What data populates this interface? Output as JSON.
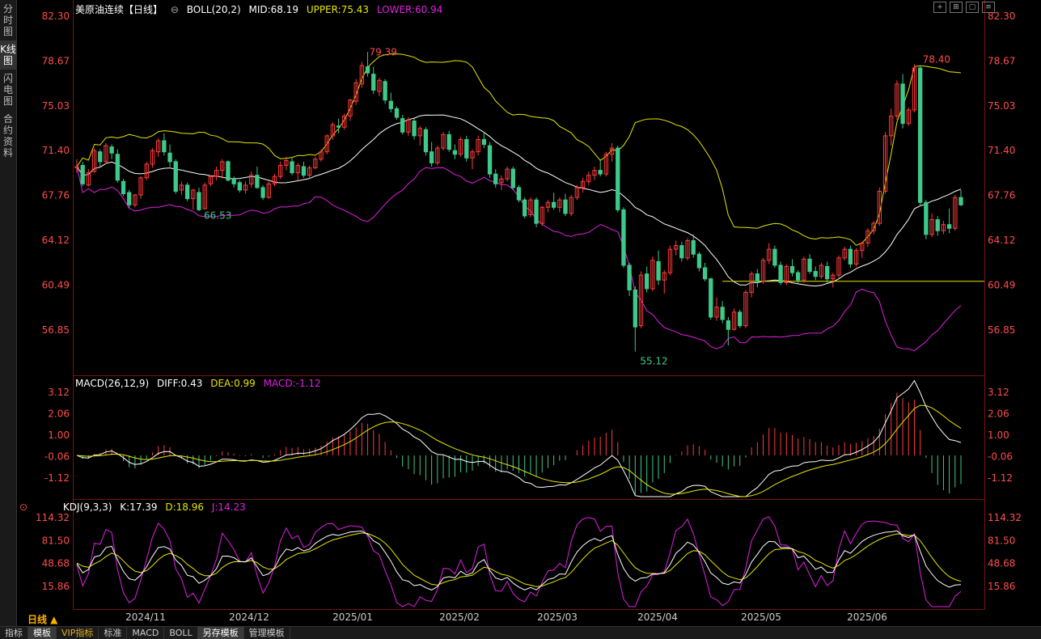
{
  "sidebar": {
    "tabs": [
      {
        "label": "分时图"
      },
      {
        "label": "K线图",
        "active": true
      },
      {
        "label": "闪电图"
      },
      {
        "label": "合约资料"
      }
    ]
  },
  "main": {
    "title": "美原油连续【日线】",
    "boll": "BOLL(20,2)",
    "mid": "MID:68.19",
    "upper": "UPPER:75.43",
    "lower": "LOWER:60.94",
    "y_ticks": [
      "82.30",
      "78.67",
      "75.03",
      "71.40",
      "67.76",
      "64.12",
      "60.49",
      "56.85"
    ],
    "annotations": {
      "high_left": "79.39",
      "high_right": "78.40",
      "low_mid": "55.12",
      "low_left": "66.53"
    },
    "colors": {
      "up": "#ff3b3b",
      "down": "#3ec98a",
      "mid": "#ffffff",
      "upper": "#e6e600",
      "lower": "#e020e0"
    }
  },
  "macd": {
    "title": "MACD(26,12,9)",
    "diff": "DIFF:0.43",
    "dea": "DEA:0.99",
    "macd": "MACD:-1.12",
    "y_ticks": [
      "3.12",
      "2.06",
      "1.00",
      "-0.06",
      "-1.12"
    ]
  },
  "kdj": {
    "title": "KDJ(9,3,3)",
    "k": "K:17.39",
    "d": "D:18.96",
    "j": "J:14.23",
    "y_ticks": [
      "114.32",
      "81.50",
      "48.68",
      "15.86"
    ]
  },
  "x_axis": {
    "period": "日线 ▲",
    "dates": [
      "2024/11",
      "2024/12",
      "2025/01",
      "2025/02",
      "2025/03",
      "2025/04",
      "2025/05",
      "2025/06"
    ]
  },
  "bottombar": {
    "tabs": [
      {
        "label": "指标"
      },
      {
        "label": "模板",
        "active": true
      },
      {
        "label": "VIP指标",
        "vip": true
      },
      {
        "label": "标准"
      },
      {
        "label": "MACD"
      },
      {
        "label": "BOLL"
      },
      {
        "label": "另存模板",
        "active": true
      },
      {
        "label": "管理模板"
      }
    ]
  },
  "chart_data": {
    "type": "candlestick",
    "yrange": [
      55.12,
      82.3
    ],
    "candles": [
      [
        70.0,
        70.7,
        69.6,
        70.1
      ],
      [
        70.2,
        70.5,
        68.5,
        68.7
      ],
      [
        68.6,
        69.9,
        68.5,
        69.6
      ],
      [
        69.7,
        71.6,
        69.6,
        71.4
      ],
      [
        71.3,
        71.5,
        70.0,
        70.5
      ],
      [
        70.5,
        72.0,
        70.3,
        71.8
      ],
      [
        71.7,
        71.9,
        70.7,
        71.2
      ],
      [
        71.1,
        71.5,
        68.8,
        69.0
      ],
      [
        68.9,
        69.1,
        67.7,
        67.9
      ],
      [
        68.0,
        68.2,
        66.7,
        67.0
      ],
      [
        67.0,
        67.9,
        66.8,
        67.8
      ],
      [
        67.8,
        69.3,
        67.5,
        69.2
      ],
      [
        69.2,
        70.5,
        69.0,
        70.3
      ],
      [
        70.3,
        71.6,
        70.0,
        71.4
      ],
      [
        71.3,
        72.4,
        70.9,
        72.2
      ],
      [
        72.2,
        72.8,
        71.0,
        71.3
      ],
      [
        71.2,
        71.9,
        70.1,
        70.5
      ],
      [
        70.5,
        70.7,
        67.9,
        68.1
      ],
      [
        68.2,
        68.9,
        67.8,
        68.6
      ],
      [
        68.6,
        68.8,
        67.3,
        67.5
      ],
      [
        67.5,
        68.3,
        66.6,
        68.2
      ],
      [
        68.0,
        68.4,
        66.5,
        66.6
      ],
      [
        66.7,
        68.8,
        66.6,
        68.6
      ],
      [
        68.7,
        69.4,
        68.5,
        69.3
      ],
      [
        69.3,
        70.1,
        69.0,
        69.8
      ],
      [
        69.8,
        70.7,
        69.1,
        70.5
      ],
      [
        70.5,
        70.6,
        68.9,
        69.0
      ],
      [
        69.1,
        69.3,
        68.4,
        68.7
      ],
      [
        68.8,
        69.0,
        68.0,
        68.2
      ],
      [
        68.2,
        68.9,
        67.9,
        68.6
      ],
      [
        68.7,
        69.7,
        68.4,
        69.4
      ],
      [
        69.4,
        70.1,
        68.3,
        68.4
      ],
      [
        68.4,
        68.6,
        67.4,
        67.6
      ],
      [
        67.6,
        68.9,
        67.5,
        68.7
      ],
      [
        68.7,
        69.5,
        68.5,
        69.3
      ],
      [
        69.3,
        70.5,
        69.1,
        70.2
      ],
      [
        70.2,
        70.9,
        69.8,
        70.6
      ],
      [
        70.5,
        70.8,
        69.4,
        69.6
      ],
      [
        69.6,
        70.4,
        69.0,
        70.2
      ],
      [
        70.1,
        70.5,
        69.2,
        69.4
      ],
      [
        69.4,
        70.2,
        69.2,
        70.0
      ],
      [
        70.0,
        70.9,
        69.9,
        70.7
      ],
      [
        70.7,
        71.5,
        70.5,
        71.3
      ],
      [
        71.3,
        72.7,
        71.1,
        72.6
      ],
      [
        72.6,
        73.7,
        72.3,
        73.5
      ],
      [
        73.4,
        74.0,
        72.8,
        73.3
      ],
      [
        73.3,
        74.4,
        73.1,
        74.2
      ],
      [
        74.2,
        75.6,
        73.8,
        75.5
      ],
      [
        75.4,
        77.2,
        75.1,
        76.9
      ],
      [
        76.8,
        78.6,
        76.5,
        78.3
      ],
      [
        78.2,
        79.4,
        77.4,
        77.7
      ],
      [
        77.6,
        78.2,
        76.0,
        76.3
      ],
      [
        76.2,
        77.3,
        75.8,
        77.1
      ],
      [
        77.0,
        77.2,
        75.2,
        75.5
      ],
      [
        75.4,
        76.1,
        74.5,
        74.8
      ],
      [
        74.8,
        75.0,
        73.9,
        74.1
      ],
      [
        74.0,
        74.3,
        72.7,
        72.9
      ],
      [
        72.9,
        74.1,
        72.6,
        73.9
      ],
      [
        73.8,
        74.0,
        72.3,
        72.6
      ],
      [
        72.6,
        73.4,
        71.8,
        73.2
      ],
      [
        73.1,
        73.3,
        71.0,
        71.3
      ],
      [
        71.3,
        72.1,
        70.1,
        70.4
      ],
      [
        70.4,
        71.8,
        70.2,
        71.6
      ],
      [
        71.6,
        72.9,
        71.4,
        72.7
      ],
      [
        72.7,
        73.0,
        71.3,
        71.5
      ],
      [
        71.4,
        71.9,
        70.7,
        71.1
      ],
      [
        71.1,
        72.5,
        70.9,
        72.3
      ],
      [
        72.3,
        72.6,
        70.5,
        70.8
      ],
      [
        70.8,
        71.5,
        69.9,
        71.3
      ],
      [
        71.3,
        72.6,
        71.0,
        72.3
      ],
      [
        72.3,
        72.9,
        71.6,
        71.9
      ],
      [
        71.8,
        72.1,
        69.2,
        69.5
      ],
      [
        69.5,
        69.9,
        68.4,
        68.7
      ],
      [
        68.8,
        69.4,
        68.2,
        69.1
      ],
      [
        69.1,
        70.1,
        68.9,
        69.9
      ],
      [
        69.9,
        70.1,
        68.2,
        68.4
      ],
      [
        68.4,
        68.6,
        67.2,
        67.4
      ],
      [
        67.4,
        67.6,
        65.9,
        66.1
      ],
      [
        66.2,
        67.6,
        66.0,
        67.4
      ],
      [
        67.4,
        67.6,
        65.2,
        65.5
      ],
      [
        65.5,
        66.9,
        65.3,
        66.8
      ],
      [
        66.8,
        67.4,
        66.4,
        67.2
      ],
      [
        67.2,
        68.0,
        66.6,
        66.8
      ],
      [
        66.8,
        67.6,
        66.4,
        67.4
      ],
      [
        67.4,
        67.9,
        66.1,
        66.3
      ],
      [
        66.3,
        67.8,
        66.1,
        67.6
      ],
      [
        67.6,
        68.6,
        67.4,
        68.4
      ],
      [
        68.4,
        69.2,
        68.0,
        68.9
      ],
      [
        68.9,
        69.7,
        68.6,
        69.4
      ],
      [
        69.4,
        70.1,
        69.0,
        69.8
      ],
      [
        69.8,
        70.7,
        69.3,
        69.5
      ],
      [
        69.5,
        71.3,
        69.3,
        71.1
      ],
      [
        71.1,
        72.0,
        70.5,
        71.6
      ],
      [
        71.6,
        71.8,
        66.4,
        66.6
      ],
      [
        66.6,
        66.8,
        61.9,
        62.1
      ],
      [
        62.1,
        62.3,
        59.6,
        60.1
      ],
      [
        60.1,
        60.4,
        55.1,
        57.1
      ],
      [
        57.2,
        61.6,
        57.0,
        61.3
      ],
      [
        61.4,
        62.0,
        59.9,
        60.2
      ],
      [
        60.2,
        62.8,
        60.0,
        62.5
      ],
      [
        62.4,
        63.3,
        60.5,
        60.9
      ],
      [
        60.9,
        61.7,
        59.8,
        61.5
      ],
      [
        61.5,
        63.7,
        61.3,
        63.4
      ],
      [
        63.4,
        64.1,
        62.9,
        63.7
      ],
      [
        63.7,
        64.0,
        62.4,
        62.7
      ],
      [
        62.7,
        64.3,
        62.5,
        64.1
      ],
      [
        64.1,
        64.6,
        62.7,
        63.0
      ],
      [
        63.0,
        63.2,
        61.6,
        61.9
      ],
      [
        61.9,
        62.3,
        60.8,
        61.0
      ],
      [
        61.0,
        61.1,
        57.7,
        57.9
      ],
      [
        57.9,
        59.5,
        57.6,
        58.7
      ],
      [
        58.7,
        59.2,
        57.4,
        57.7
      ],
      [
        57.6,
        57.9,
        55.6,
        56.9
      ],
      [
        56.9,
        58.6,
        56.8,
        58.3
      ],
      [
        58.3,
        58.5,
        57.0,
        57.2
      ],
      [
        57.2,
        60.1,
        57.0,
        59.9
      ],
      [
        59.9,
        61.6,
        59.5,
        61.4
      ],
      [
        61.4,
        61.8,
        60.3,
        60.8
      ],
      [
        60.8,
        62.7,
        60.6,
        62.5
      ],
      [
        62.5,
        63.9,
        62.2,
        63.4
      ],
      [
        63.4,
        63.7,
        61.9,
        62.1
      ],
      [
        62.1,
        62.4,
        60.5,
        60.7
      ],
      [
        60.7,
        62.2,
        60.5,
        62.0
      ],
      [
        62.0,
        62.6,
        61.2,
        61.5
      ],
      [
        61.5,
        61.7,
        60.6,
        60.9
      ],
      [
        60.9,
        62.8,
        60.7,
        62.6
      ],
      [
        62.6,
        63.0,
        61.4,
        61.6
      ],
      [
        61.6,
        62.0,
        60.9,
        61.2
      ],
      [
        61.2,
        62.3,
        61.0,
        62.1
      ],
      [
        62.0,
        62.4,
        60.7,
        61.0
      ],
      [
        61.0,
        61.5,
        60.3,
        61.3
      ],
      [
        61.3,
        62.9,
        61.1,
        62.7
      ],
      [
        62.7,
        63.6,
        62.5,
        63.4
      ],
      [
        63.4,
        63.7,
        61.9,
        62.2
      ],
      [
        62.2,
        63.5,
        62.0,
        63.3
      ],
      [
        63.3,
        64.0,
        62.7,
        63.9
      ],
      [
        63.9,
        65.1,
        63.6,
        64.9
      ],
      [
        64.9,
        65.7,
        64.6,
        65.5
      ],
      [
        65.5,
        68.4,
        65.3,
        68.1
      ],
      [
        68.1,
        72.9,
        67.9,
        72.6
      ],
      [
        72.6,
        74.8,
        71.8,
        74.2
      ],
      [
        74.2,
        77.1,
        73.9,
        76.8
      ],
      [
        76.8,
        77.6,
        73.2,
        73.6
      ],
      [
        73.6,
        74.9,
        73.4,
        74.7
      ],
      [
        74.7,
        78.4,
        74.5,
        78.1
      ],
      [
        78.1,
        78.3,
        66.9,
        67.2
      ],
      [
        67.2,
        67.4,
        64.2,
        64.6
      ],
      [
        64.6,
        66.3,
        64.4,
        65.8
      ],
      [
        65.8,
        66.1,
        64.5,
        64.9
      ],
      [
        64.9,
        65.7,
        64.6,
        65.4
      ],
      [
        65.4,
        66.7,
        64.7,
        65.1
      ],
      [
        65.1,
        67.8,
        64.9,
        67.6
      ],
      [
        67.6,
        68.2,
        66.9,
        67.0
      ]
    ]
  }
}
